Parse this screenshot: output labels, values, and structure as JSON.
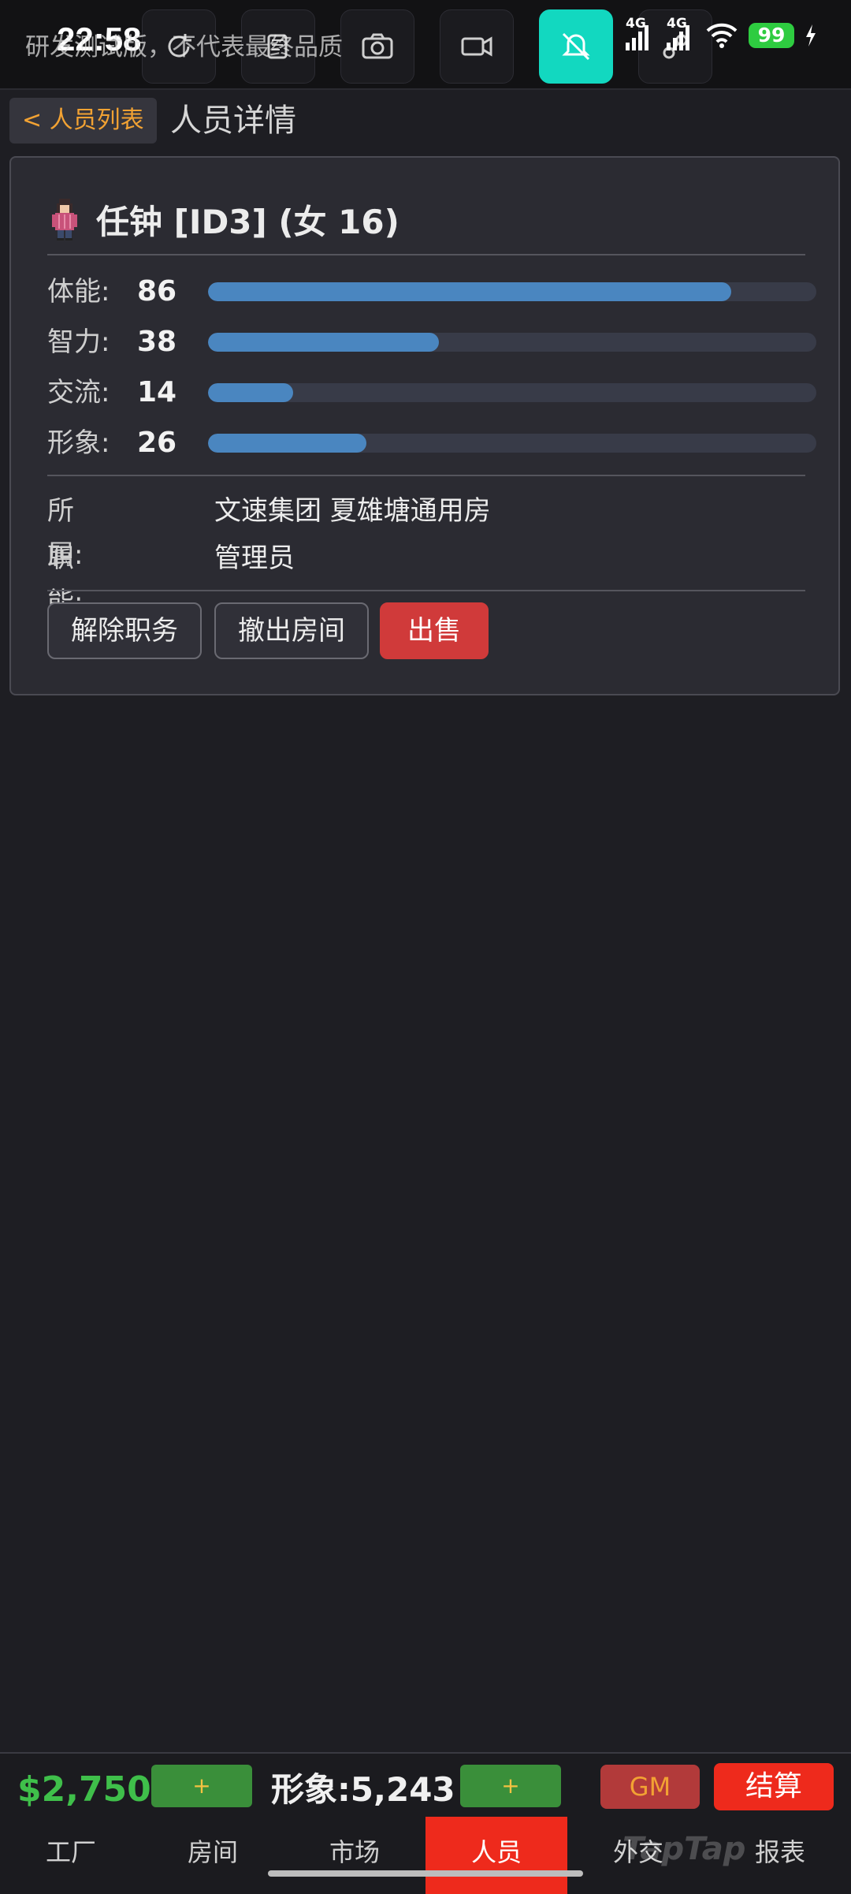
{
  "status_bar": {
    "time": "22:58",
    "network_label": "4G",
    "battery_level": "99",
    "watermark": "研发测试版，不代表最终品质"
  },
  "header": {
    "back_label": "< 人员列表",
    "title": "人员详情"
  },
  "person": {
    "name_line": "任钟 [ID3] (女 16)",
    "stats": [
      {
        "label": "体能:",
        "value": "86",
        "fill": 0.86
      },
      {
        "label": "智力:",
        "value": "38",
        "fill": 0.38
      },
      {
        "label": "交流:",
        "value": "14",
        "fill": 0.14
      },
      {
        "label": "形象:",
        "value": "26",
        "fill": 0.26
      }
    ],
    "affiliation_label": "所属:",
    "affiliation_value": "文速集团 夏雄塘通用房",
    "role_label": "职能:",
    "role_value": "管理员"
  },
  "actions": {
    "dismiss": "解除职务",
    "leave_room": "撤出房间",
    "sell": "出售"
  },
  "bottom": {
    "money": "$2,750",
    "plus": "+",
    "image_stat": "形象:5,243",
    "gm": "GM",
    "settle": "结算",
    "tabs": [
      "工厂",
      "房间",
      "市场",
      "人员",
      "外交",
      "报表"
    ],
    "active_tab": "人员",
    "watermark": "TapTap"
  },
  "colors": {
    "accent_orange": "#f2a233",
    "bar_fill": "#4a86c0",
    "money_green": "#3fbf4a",
    "danger_red": "#ee2a1c"
  }
}
